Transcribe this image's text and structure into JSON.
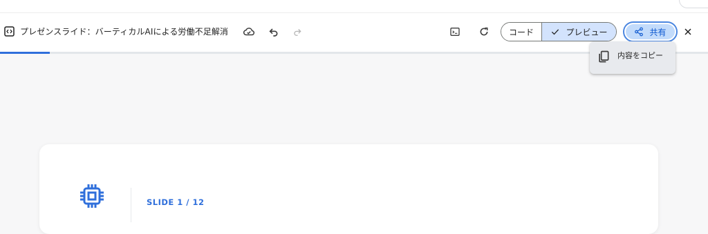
{
  "header": {
    "title": "プレゼンスライド：バーティカルAIによる労働不足解消",
    "doc_icon": "code-doc-icon",
    "icons": [
      "cloud-save-icon",
      "undo-icon",
      "redo-icon",
      "terminal-icon",
      "refresh-icon",
      "close-icon"
    ]
  },
  "toggle": {
    "code_label": "コード",
    "preview_label": "プレビュー",
    "selected": "preview"
  },
  "share": {
    "label": "共有",
    "icon": "share-icon"
  },
  "menu": {
    "copy_label": "内容をコピー",
    "icon": "copy-icon"
  },
  "progress": {
    "fraction": 0.07
  },
  "slide": {
    "counter": "SLIDE 1 / 12",
    "icon": "chip-icon"
  },
  "colors": {
    "accent": "#2f6fdb",
    "selected_segment": "#d3e3fd",
    "share_fill": "#c2dbfb",
    "menu_bg": "#e8eaee",
    "page_bg": "#f7f7f8"
  }
}
